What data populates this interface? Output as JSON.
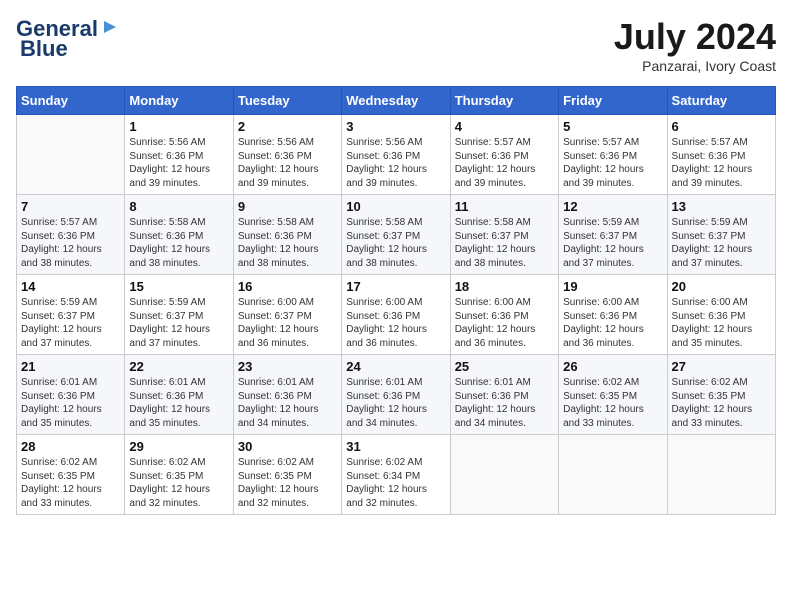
{
  "header": {
    "logo_line1": "General",
    "logo_line2": "Blue",
    "month_year": "July 2024",
    "location": "Panzarai, Ivory Coast"
  },
  "days_of_week": [
    "Sunday",
    "Monday",
    "Tuesday",
    "Wednesday",
    "Thursday",
    "Friday",
    "Saturday"
  ],
  "weeks": [
    [
      {
        "day": "",
        "empty": true
      },
      {
        "day": "1",
        "sunrise": "Sunrise: 5:56 AM",
        "sunset": "Sunset: 6:36 PM",
        "daylight": "Daylight: 12 hours and 39 minutes."
      },
      {
        "day": "2",
        "sunrise": "Sunrise: 5:56 AM",
        "sunset": "Sunset: 6:36 PM",
        "daylight": "Daylight: 12 hours and 39 minutes."
      },
      {
        "day": "3",
        "sunrise": "Sunrise: 5:56 AM",
        "sunset": "Sunset: 6:36 PM",
        "daylight": "Daylight: 12 hours and 39 minutes."
      },
      {
        "day": "4",
        "sunrise": "Sunrise: 5:57 AM",
        "sunset": "Sunset: 6:36 PM",
        "daylight": "Daylight: 12 hours and 39 minutes."
      },
      {
        "day": "5",
        "sunrise": "Sunrise: 5:57 AM",
        "sunset": "Sunset: 6:36 PM",
        "daylight": "Daylight: 12 hours and 39 minutes."
      },
      {
        "day": "6",
        "sunrise": "Sunrise: 5:57 AM",
        "sunset": "Sunset: 6:36 PM",
        "daylight": "Daylight: 12 hours and 39 minutes."
      }
    ],
    [
      {
        "day": "7",
        "sunrise": "Sunrise: 5:57 AM",
        "sunset": "Sunset: 6:36 PM",
        "daylight": "Daylight: 12 hours and 38 minutes."
      },
      {
        "day": "8",
        "sunrise": "Sunrise: 5:58 AM",
        "sunset": "Sunset: 6:36 PM",
        "daylight": "Daylight: 12 hours and 38 minutes."
      },
      {
        "day": "9",
        "sunrise": "Sunrise: 5:58 AM",
        "sunset": "Sunset: 6:36 PM",
        "daylight": "Daylight: 12 hours and 38 minutes."
      },
      {
        "day": "10",
        "sunrise": "Sunrise: 5:58 AM",
        "sunset": "Sunset: 6:37 PM",
        "daylight": "Daylight: 12 hours and 38 minutes."
      },
      {
        "day": "11",
        "sunrise": "Sunrise: 5:58 AM",
        "sunset": "Sunset: 6:37 PM",
        "daylight": "Daylight: 12 hours and 38 minutes."
      },
      {
        "day": "12",
        "sunrise": "Sunrise: 5:59 AM",
        "sunset": "Sunset: 6:37 PM",
        "daylight": "Daylight: 12 hours and 37 minutes."
      },
      {
        "day": "13",
        "sunrise": "Sunrise: 5:59 AM",
        "sunset": "Sunset: 6:37 PM",
        "daylight": "Daylight: 12 hours and 37 minutes."
      }
    ],
    [
      {
        "day": "14",
        "sunrise": "Sunrise: 5:59 AM",
        "sunset": "Sunset: 6:37 PM",
        "daylight": "Daylight: 12 hours and 37 minutes."
      },
      {
        "day": "15",
        "sunrise": "Sunrise: 5:59 AM",
        "sunset": "Sunset: 6:37 PM",
        "daylight": "Daylight: 12 hours and 37 minutes."
      },
      {
        "day": "16",
        "sunrise": "Sunrise: 6:00 AM",
        "sunset": "Sunset: 6:37 PM",
        "daylight": "Daylight: 12 hours and 36 minutes."
      },
      {
        "day": "17",
        "sunrise": "Sunrise: 6:00 AM",
        "sunset": "Sunset: 6:36 PM",
        "daylight": "Daylight: 12 hours and 36 minutes."
      },
      {
        "day": "18",
        "sunrise": "Sunrise: 6:00 AM",
        "sunset": "Sunset: 6:36 PM",
        "daylight": "Daylight: 12 hours and 36 minutes."
      },
      {
        "day": "19",
        "sunrise": "Sunrise: 6:00 AM",
        "sunset": "Sunset: 6:36 PM",
        "daylight": "Daylight: 12 hours and 36 minutes."
      },
      {
        "day": "20",
        "sunrise": "Sunrise: 6:00 AM",
        "sunset": "Sunset: 6:36 PM",
        "daylight": "Daylight: 12 hours and 35 minutes."
      }
    ],
    [
      {
        "day": "21",
        "sunrise": "Sunrise: 6:01 AM",
        "sunset": "Sunset: 6:36 PM",
        "daylight": "Daylight: 12 hours and 35 minutes."
      },
      {
        "day": "22",
        "sunrise": "Sunrise: 6:01 AM",
        "sunset": "Sunset: 6:36 PM",
        "daylight": "Daylight: 12 hours and 35 minutes."
      },
      {
        "day": "23",
        "sunrise": "Sunrise: 6:01 AM",
        "sunset": "Sunset: 6:36 PM",
        "daylight": "Daylight: 12 hours and 34 minutes."
      },
      {
        "day": "24",
        "sunrise": "Sunrise: 6:01 AM",
        "sunset": "Sunset: 6:36 PM",
        "daylight": "Daylight: 12 hours and 34 minutes."
      },
      {
        "day": "25",
        "sunrise": "Sunrise: 6:01 AM",
        "sunset": "Sunset: 6:36 PM",
        "daylight": "Daylight: 12 hours and 34 minutes."
      },
      {
        "day": "26",
        "sunrise": "Sunrise: 6:02 AM",
        "sunset": "Sunset: 6:35 PM",
        "daylight": "Daylight: 12 hours and 33 minutes."
      },
      {
        "day": "27",
        "sunrise": "Sunrise: 6:02 AM",
        "sunset": "Sunset: 6:35 PM",
        "daylight": "Daylight: 12 hours and 33 minutes."
      }
    ],
    [
      {
        "day": "28",
        "sunrise": "Sunrise: 6:02 AM",
        "sunset": "Sunset: 6:35 PM",
        "daylight": "Daylight: 12 hours and 33 minutes."
      },
      {
        "day": "29",
        "sunrise": "Sunrise: 6:02 AM",
        "sunset": "Sunset: 6:35 PM",
        "daylight": "Daylight: 12 hours and 32 minutes."
      },
      {
        "day": "30",
        "sunrise": "Sunrise: 6:02 AM",
        "sunset": "Sunset: 6:35 PM",
        "daylight": "Daylight: 12 hours and 32 minutes."
      },
      {
        "day": "31",
        "sunrise": "Sunrise: 6:02 AM",
        "sunset": "Sunset: 6:34 PM",
        "daylight": "Daylight: 12 hours and 32 minutes."
      },
      {
        "day": "",
        "empty": true
      },
      {
        "day": "",
        "empty": true
      },
      {
        "day": "",
        "empty": true
      }
    ]
  ]
}
